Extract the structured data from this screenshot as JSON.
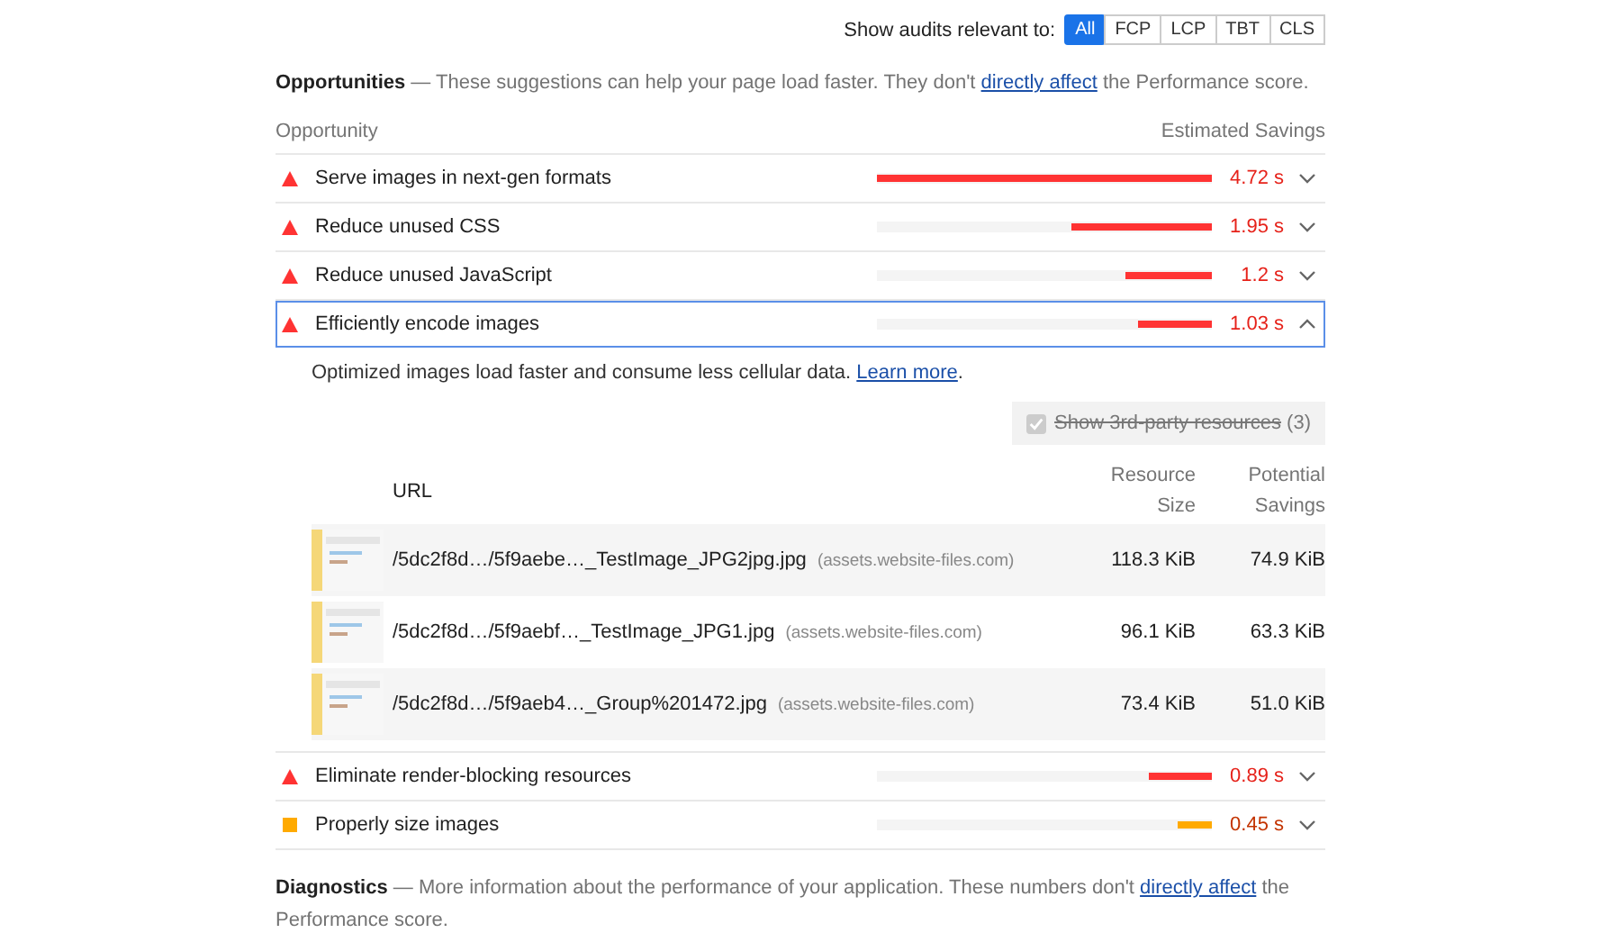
{
  "filter": {
    "label": "Show audits relevant to:",
    "options": [
      {
        "label": "All",
        "selected": true
      },
      {
        "label": "FCP",
        "selected": false
      },
      {
        "label": "LCP",
        "selected": false
      },
      {
        "label": "TBT",
        "selected": false
      },
      {
        "label": "CLS",
        "selected": false
      }
    ]
  },
  "opportunities": {
    "title": "Opportunities",
    "dash": "—",
    "text_before": "These suggestions can help your page load faster. They don't",
    "link": "directly affect",
    "text_after": "the Performance score."
  },
  "columns": {
    "left": "Opportunity",
    "right": "Estimated Savings"
  },
  "audits": [
    {
      "kind": "fail",
      "title": "Serve images in next-gen formats",
      "level": 1.0,
      "savings": "4.72 s",
      "expanded": false
    },
    {
      "kind": "fail",
      "title": "Reduce unused CSS",
      "level": 0.42,
      "savings": "1.95 s",
      "expanded": false
    },
    {
      "kind": "fail",
      "title": "Reduce unused JavaScript",
      "level": 0.26,
      "savings": "1.2 s",
      "expanded": false
    },
    {
      "kind": "fail",
      "title": "Efficiently encode images",
      "level": 0.22,
      "savings": "1.03 s",
      "expanded": true,
      "details": {
        "description": "Optimized images load faster and consume less cellular data.",
        "link": "Learn more",
        "link_after": ".",
        "checkbox": {
          "label": "Show 3rd-party resources",
          "count": "(3)",
          "checked": true,
          "disabled": true
        },
        "table": {
          "url_heading": "URL",
          "size_heading": [
            "Resource",
            "Size"
          ],
          "savings_heading": [
            "Potential",
            "Savings"
          ],
          "rows": [
            {
              "url": "/5dc2f8d…/5f9aebe…_TestImage_JPG2jpg.jpg",
              "host": "(assets.website-files.com)",
              "size": "118.3 KiB",
              "savings": "74.9 KiB"
            },
            {
              "url": "/5dc2f8d…/5f9aebf…_TestImage_JPG1.jpg",
              "host": "(assets.website-files.com)",
              "size": "96.1 KiB",
              "savings": "63.3 KiB"
            },
            {
              "url": "/5dc2f8d…/5f9aeb4…_Group%201472.jpg",
              "host": "(assets.website-files.com)",
              "size": "73.4 KiB",
              "savings": "51.0 KiB"
            }
          ]
        }
      }
    },
    {
      "kind": "fail",
      "title": "Eliminate render-blocking resources",
      "level": 0.19,
      "savings": "0.89 s",
      "expanded": false
    },
    {
      "kind": "average",
      "title": "Properly size images",
      "level": 0.1,
      "savings": "0.45 s",
      "expanded": false
    }
  ],
  "diagnostics": {
    "title": "Diagnostics",
    "dash": "—",
    "text_before": "More information about the performance of your application. These numbers don't",
    "link": "directly affect",
    "text_after": "the Performance score."
  }
}
